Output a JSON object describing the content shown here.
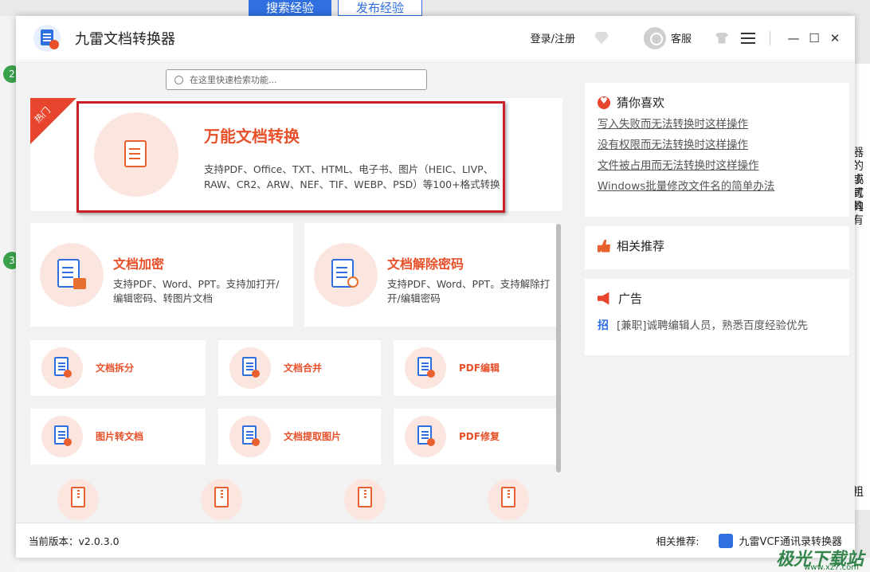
{
  "background": {
    "tabs": [
      "搜索经验",
      "发布经验"
    ],
    "badges": [
      "2",
      "3"
    ],
    "right_text": [
      "器",
      "的小",
      "或可",
      "式的",
      "具有",
      "粗"
    ]
  },
  "app": {
    "title": "九雷文档转换器",
    "login_label": "登录/注册",
    "service_label": "客服",
    "window_controls": [
      "—",
      "☐",
      "✕"
    ]
  },
  "search": {
    "placeholder": "在这里快速检索功能..."
  },
  "hot": {
    "ribbon": "热门",
    "title": "万能文档转换",
    "desc": "支持PDF、Office、TXT、HTML、电子书、图片（HEIC、LIVP、RAW、CR2、ARW、NEF、TIF、WEBP、PSD）等100+格式转换"
  },
  "features_large": [
    {
      "title": "文档加密",
      "desc": "支持PDF、Word、PPT。支持加打开/编辑密码、转图片文档"
    },
    {
      "title": "文档解除密码",
      "desc": "支持PDF、Word、PPT。支持解除打开/编辑密码"
    }
  ],
  "features_small": [
    {
      "title": "文档拆分"
    },
    {
      "title": "文档合并"
    },
    {
      "title": "PDF编辑"
    },
    {
      "title": "图片转文档"
    },
    {
      "title": "文档提取图片"
    },
    {
      "title": "PDF修复"
    }
  ],
  "right": {
    "guess_title": "猜你喜欢",
    "guess_links": [
      "写入失败而无法转换时这样操作",
      "没有权限而无法转换时这样操作",
      "文件被占用而无法转换时这样操作",
      "Windows批量修改文件名的简单办法"
    ],
    "recommend_title": "相关推荐",
    "ad_title": "广告",
    "ad_icon": "招",
    "ad_text": "[兼职]诚聘编辑人员，熟悉百度经验优先"
  },
  "footer": {
    "version": "当前版本：v2.0.3.0",
    "related_label": "相关推荐:",
    "related_app": "九雷VCF通讯录转换器"
  },
  "watermark": {
    "text": "极光下载站",
    "sub": "www.xz7.com"
  },
  "colors": {
    "accent": "#e8502a",
    "brand_blue": "#2f6fe0",
    "highlight_box": "#c8202a"
  }
}
